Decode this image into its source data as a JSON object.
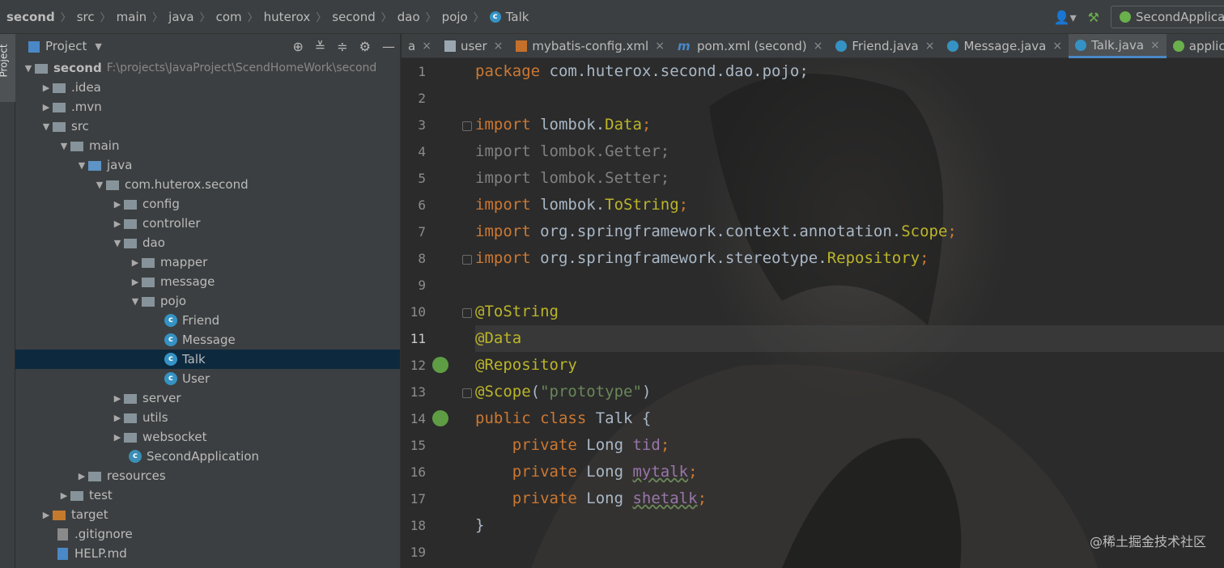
{
  "navbar": {
    "crumbs": [
      "second",
      "src",
      "main",
      "java",
      "com",
      "huterox",
      "second",
      "dao",
      "pojo",
      "Talk"
    ],
    "run_config": "SecondApplica"
  },
  "stripe": {
    "project_label": "Project"
  },
  "project_panel": {
    "header": "Project",
    "tree": [
      {
        "label": "second",
        "hint": "F:\\projects\\JavaProject\\ScendHomeWork\\second"
      },
      {
        "label": ".idea"
      },
      {
        "label": ".mvn"
      },
      {
        "label": "src"
      },
      {
        "label": "main"
      },
      {
        "label": "java"
      },
      {
        "label": "com.huterox.second"
      },
      {
        "label": "config"
      },
      {
        "label": "controller"
      },
      {
        "label": "dao"
      },
      {
        "label": "mapper"
      },
      {
        "label": "message"
      },
      {
        "label": "pojo"
      },
      {
        "label": "Friend"
      },
      {
        "label": "Message"
      },
      {
        "label": "Talk"
      },
      {
        "label": "User"
      },
      {
        "label": "server"
      },
      {
        "label": "utils"
      },
      {
        "label": "websocket"
      },
      {
        "label": "SecondApplication"
      },
      {
        "label": "resources"
      },
      {
        "label": "test"
      },
      {
        "label": "target"
      },
      {
        "label": ".gitignore"
      },
      {
        "label": "HELP.md"
      }
    ]
  },
  "editor": {
    "tabs": [
      {
        "label": "a"
      },
      {
        "label": "user"
      },
      {
        "label": "mybatis-config.xml"
      },
      {
        "label": "pom.xml (second)"
      },
      {
        "label": "Friend.java"
      },
      {
        "label": "Message.java"
      },
      {
        "label": "Talk.java"
      },
      {
        "label": "applicat"
      }
    ],
    "line_numbers": [
      "1",
      "2",
      "3",
      "4",
      "5",
      "6",
      "7",
      "8",
      "9",
      "10",
      "11",
      "12",
      "13",
      "14",
      "15",
      "16",
      "17",
      "18",
      "19"
    ],
    "code": {
      "l1_kw": "package",
      "l1_rest": " com.huterox.second.dao.pojo;",
      "l3_kw": "import",
      "l3_pkg": " lombok.",
      "l3_cls": "Data",
      "l3_end": ";",
      "l4": "import lombok.Getter;",
      "l5": "import lombok.Setter;",
      "l6_kw": "import",
      "l6_pkg": " lombok.",
      "l6_cls": "ToString",
      "l6_end": ";",
      "l7_kw": "import",
      "l7_pkg": " org.springframework.context.annotation.",
      "l7_cls": "Scope",
      "l7_end": ";",
      "l8_kw": "import",
      "l8_pkg": " org.springframework.stereotype.",
      "l8_cls": "Repository",
      "l8_end": ";",
      "l10": "@ToString",
      "l11": "@Data",
      "l12": "@Repository",
      "l13_ann": "@Scope",
      "l13_open": "(",
      "l13_str": "\"prototype\"",
      "l13_close": ")",
      "l14_kw": "public class",
      "l14_rest": " Talk {",
      "l15_kw": "    private",
      "l15_type": " Long ",
      "l15_fld": "tid",
      "l15_end": ";",
      "l16_kw": "    private",
      "l16_type": " Long ",
      "l16_fld": "mytalk",
      "l16_end": ";",
      "l17_kw": "    private",
      "l17_type": " Long ",
      "l17_fld": "shetalk",
      "l17_end": ";",
      "l18": "}"
    }
  },
  "watermark": "@稀土掘金技术社区"
}
